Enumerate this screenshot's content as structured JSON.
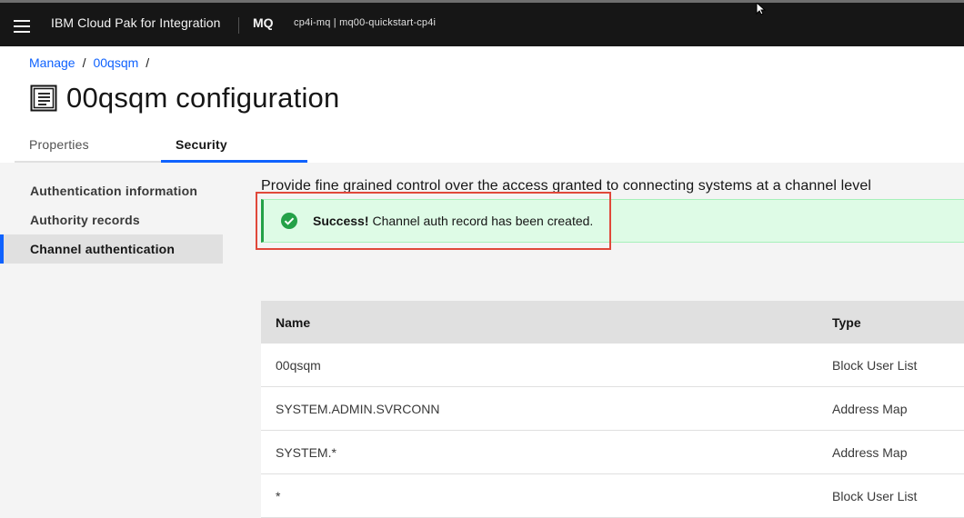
{
  "header": {
    "brand": "IBM Cloud Pak for Integration",
    "product": "MQ",
    "instance": "cp4i-mq | mq00-quickstart-cp4i"
  },
  "breadcrumb": {
    "items": [
      "Manage",
      "00qsqm"
    ],
    "separator": "/"
  },
  "page": {
    "title": "00qsqm configuration",
    "icon": "document-list-icon"
  },
  "tabs": [
    {
      "label": "Properties",
      "active": false
    },
    {
      "label": "Security",
      "active": true
    }
  ],
  "sidebar": {
    "items": [
      {
        "label": "Authentication information",
        "active": false
      },
      {
        "label": "Authority records",
        "active": false
      },
      {
        "label": "Channel authentication",
        "active": true
      }
    ]
  },
  "main": {
    "description": "Provide fine grained control over the access granted to connecting systems at a channel level",
    "notification": {
      "kind": "success",
      "title": "Success!",
      "message": "Channel auth record has been created.",
      "icon": "checkmark-filled-icon",
      "color": "#24a148"
    },
    "table": {
      "columns": [
        "Name",
        "Type"
      ],
      "rows": [
        {
          "name": "00qsqm",
          "type": "Block User List"
        },
        {
          "name": "SYSTEM.ADMIN.SVRCONN",
          "type": "Address Map"
        },
        {
          "name": "SYSTEM.*",
          "type": "Address Map"
        },
        {
          "name": "*",
          "type": "Block User List"
        }
      ]
    }
  },
  "colors": {
    "accent": "#0f62fe",
    "header_bg": "#161616",
    "success": "#24a148",
    "highlight": "#e0483a"
  }
}
